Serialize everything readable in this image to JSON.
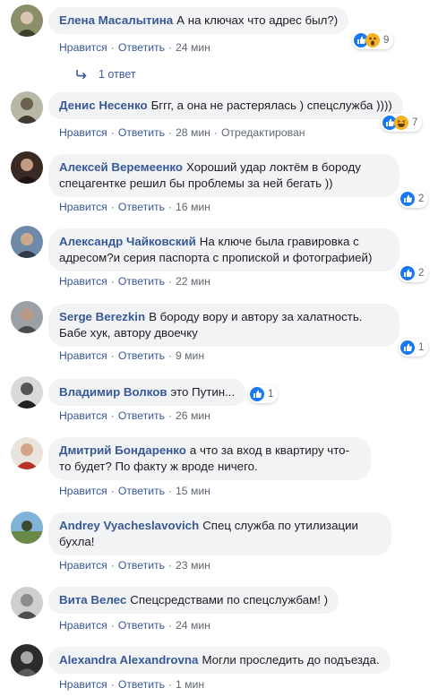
{
  "labels": {
    "like": "Нравится",
    "reply": "Ответить",
    "dot": "·"
  },
  "replies_link": "1 ответ",
  "comments": [
    {
      "author": "Елена Масалытина",
      "text": "А на ключах что адрес был?)",
      "reactions": [
        "like",
        "wow"
      ],
      "count": "9",
      "time": "24 мин",
      "edited": ""
    },
    {
      "author": "Денис Несенко",
      "text": "Бггг, а она не растерялась ) спецслужба ))))",
      "reactions": [
        "like",
        "haha"
      ],
      "count": "7",
      "time": "28 мин",
      "edited": "Отредактирован"
    },
    {
      "author": "Алексей Веремеенко",
      "text": "Хороший удар локтём в бороду спецагентке решил бы проблемы за ней бегать ))",
      "reactions": [
        "like"
      ],
      "count": "2",
      "time": "16 мин",
      "edited": ""
    },
    {
      "author": "Александр Чайковский",
      "text": "На ключе была гравировка с адресом?и серия паспорта с пропиской и фотографией)",
      "reactions": [
        "like"
      ],
      "count": "2",
      "time": "22 мин",
      "edited": ""
    },
    {
      "author": "Serge Berezkin",
      "text": "В бороду вору и автору за халатность. Бабе хук, автору двоечку",
      "reactions": [
        "like"
      ],
      "count": "1",
      "time": "9 мин",
      "edited": ""
    },
    {
      "author": "Владимир Волков",
      "text": "это Путин...",
      "reactions": [
        "like"
      ],
      "count": "1",
      "time": "26 мин",
      "edited": ""
    },
    {
      "author": "Дмитрий Бондаренко",
      "text": "а что за вход в квартиру что-то будет? По факту ж вроде ничего.",
      "reactions": [],
      "count": "",
      "time": "15 мин",
      "edited": ""
    },
    {
      "author": "Andrey Vyacheslavovich",
      "text": "Спец служба по утилизации бухла!",
      "reactions": [],
      "count": "",
      "time": "23 мин",
      "edited": ""
    },
    {
      "author": "Вита Велес",
      "text": "Спецсредствами по спецслужбам! )",
      "reactions": [],
      "count": "",
      "time": "24 мин",
      "edited": ""
    },
    {
      "author": "Alexandra Alexandrovna",
      "text": "Могли проследить до подъезда.",
      "reactions": [],
      "count": "",
      "time": "1 мин",
      "edited": ""
    }
  ],
  "colors": {
    "link": "#385898",
    "meta": "#606770",
    "bubble": "#f2f3f5",
    "like": "#1877f2",
    "emoji": "#f7b125"
  }
}
